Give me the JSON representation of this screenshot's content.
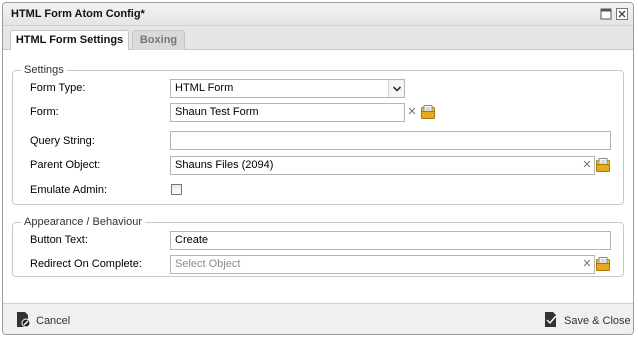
{
  "window": {
    "title": "HTML Form Atom Config*"
  },
  "tabs": [
    {
      "label": "HTML Form Settings",
      "active": true
    },
    {
      "label": "Boxing",
      "active": false
    }
  ],
  "settings": {
    "legend": "Settings",
    "form_type": {
      "label": "Form Type:",
      "value": "HTML Form"
    },
    "form": {
      "label": "Form:",
      "value": "Shaun Test Form"
    },
    "query_string": {
      "label": "Query String:",
      "value": ""
    },
    "parent_object": {
      "label": "Parent Object:",
      "value": "Shauns Files (2094)"
    },
    "emulate_admin": {
      "label": "Emulate Admin:",
      "checked": false
    }
  },
  "appearance": {
    "legend": "Appearance / Behaviour",
    "button_text": {
      "label": "Button Text:",
      "value": "Create"
    },
    "redirect": {
      "label": "Redirect On Complete:",
      "placeholder": "Select Object"
    }
  },
  "footer": {
    "cancel_label": "Cancel",
    "save_label": "Save & Close"
  },
  "icons": {
    "clear": "clear-x-icon",
    "picker": "folder-picker-icon"
  }
}
